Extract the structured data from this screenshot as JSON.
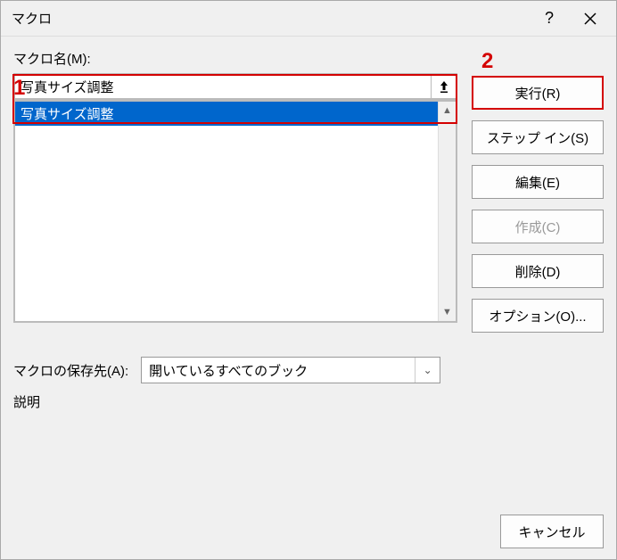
{
  "title": "マクロ",
  "labels": {
    "macro_name": "マクロ名(M):",
    "storage": "マクロの保存先(A):",
    "description": "説明"
  },
  "input": {
    "value": "写真サイズ調整"
  },
  "list": {
    "items": [
      {
        "label": "写真サイズ調整"
      }
    ]
  },
  "storage": {
    "selected": "開いているすべてのブック"
  },
  "buttons": {
    "run": "実行(R)",
    "step_in": "ステップ イン(S)",
    "edit": "編集(E)",
    "create": "作成(C)",
    "delete": "削除(D)",
    "options": "オプション(O)...",
    "cancel": "キャンセル"
  },
  "annotations": {
    "one": "1",
    "two": "2"
  }
}
